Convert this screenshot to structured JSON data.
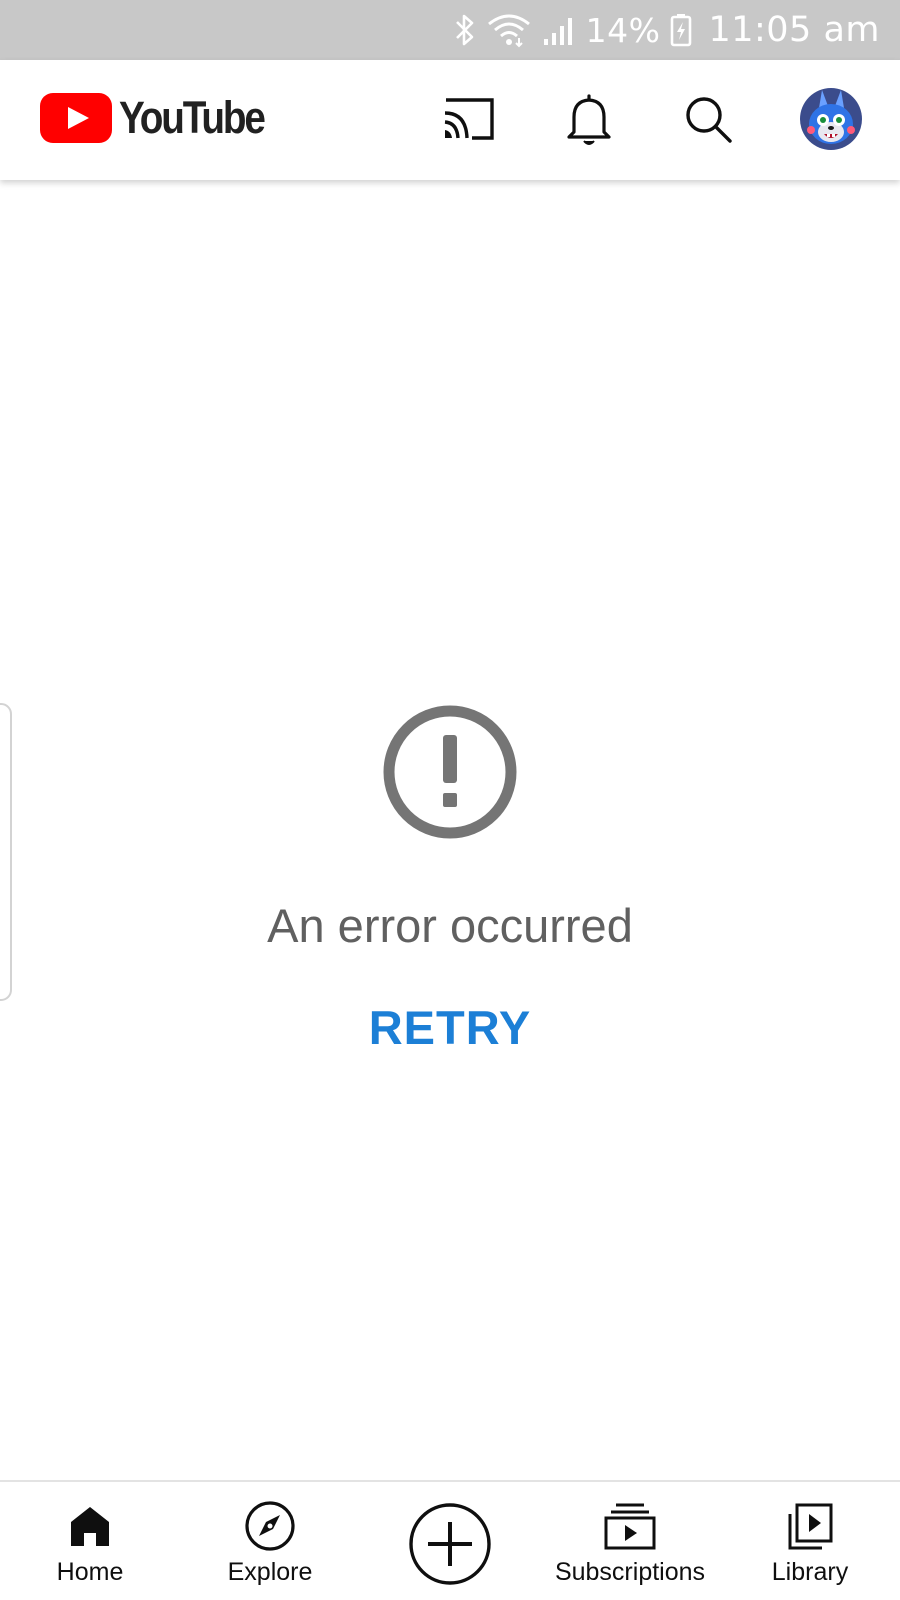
{
  "status_bar": {
    "battery_percent": "14%",
    "time": "11:05 am",
    "icons": [
      "bluetooth-icon",
      "wifi-icon",
      "signal-icon",
      "battery-charging-icon"
    ],
    "background": "#c8c8c8"
  },
  "header": {
    "logo_text": "YouTube",
    "logo_color": "#ff0000",
    "icons": [
      "cast-icon",
      "bell-icon",
      "search-icon",
      "avatar"
    ]
  },
  "main": {
    "error_icon": "exclamation-circle-icon",
    "error_message": "An error occurred",
    "retry_label": "RETRY",
    "retry_color": "#1c7fd6"
  },
  "bottom_nav": {
    "items": [
      {
        "label": "Home",
        "icon": "home-icon",
        "active": true
      },
      {
        "label": "Explore",
        "icon": "compass-icon"
      },
      {
        "label": "",
        "icon": "create-plus-icon"
      },
      {
        "label": "Subscriptions",
        "icon": "subscriptions-icon"
      },
      {
        "label": "Library",
        "icon": "library-icon"
      }
    ]
  }
}
